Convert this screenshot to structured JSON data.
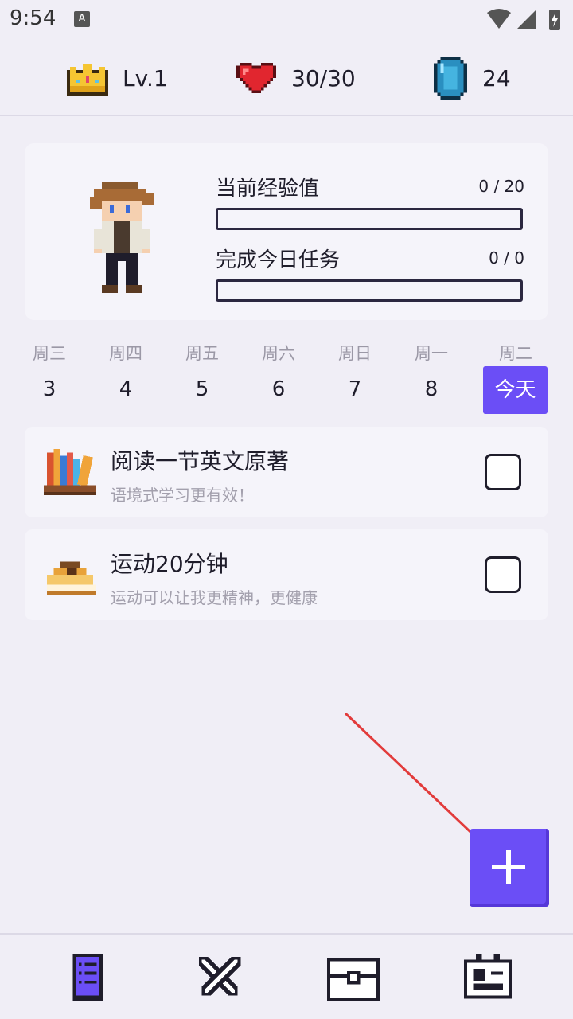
{
  "status_bar": {
    "time": "9:54",
    "a_badge": "A"
  },
  "header": {
    "level": {
      "icon": "crown-icon",
      "value": "Lv.1"
    },
    "hp": {
      "icon": "heart-icon",
      "value": "30/30"
    },
    "gems": {
      "icon": "gem-icon",
      "value": "24"
    }
  },
  "profile": {
    "exp_label": "当前经验值",
    "exp_value": "0 / 20",
    "exp_progress": 0,
    "tasks_label": "完成今日任务",
    "tasks_value": "0 / 0",
    "tasks_progress": 0
  },
  "week": {
    "days": [
      {
        "name": "周三",
        "num": "3"
      },
      {
        "name": "周四",
        "num": "4"
      },
      {
        "name": "周五",
        "num": "5"
      },
      {
        "name": "周六",
        "num": "6"
      },
      {
        "name": "周日",
        "num": "7"
      },
      {
        "name": "周一",
        "num": "8"
      },
      {
        "name": "周二",
        "num": ""
      }
    ],
    "today_label": "今天"
  },
  "tasks": [
    {
      "icon": "books-icon",
      "title": "阅读一节英文原著",
      "subtitle": "语境式学习更有效！",
      "checked": false
    },
    {
      "icon": "sneaker-icon",
      "title": "运动20分钟",
      "subtitle": "运动可以让我更精神，更健康",
      "checked": false
    }
  ],
  "fab": {
    "icon": "plus-icon"
  },
  "bottom_nav": [
    {
      "icon": "task-list-icon",
      "active": true
    },
    {
      "icon": "crossed-swords-icon",
      "active": false
    },
    {
      "icon": "treasure-chest-icon",
      "active": false
    },
    {
      "icon": "profile-card-icon",
      "active": false
    }
  ],
  "colors": {
    "accent": "#6b4ef6",
    "background": "#f0eef6",
    "card": "#f5f4fa",
    "arrow": "#e23b3b"
  }
}
